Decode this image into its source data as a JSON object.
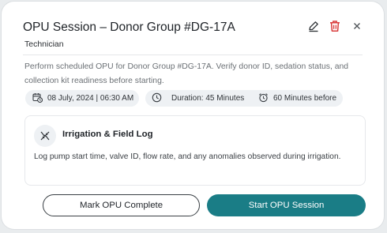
{
  "header": {
    "title": "OPU Session – Donor Group #DG-17A",
    "subtitle": "Technician",
    "edit_icon": "pencil-icon",
    "delete_icon": "trash-icon",
    "close_icon": "close-icon"
  },
  "description": "Perform scheduled OPU for Donor Group #DG-17A. Verify donor ID, sedation status, and collection kit readiness before starting.",
  "chips": [
    {
      "icon": "calendar-clock-icon",
      "label": "08 July, 2024 | 06:30 AM"
    },
    {
      "icon": "clock-icon",
      "label": "Duration: 45 Minutes"
    },
    {
      "icon": "alarm-icon",
      "label": "60 Minutes before"
    }
  ],
  "panel": {
    "icon": "dna-icon",
    "title": "Irrigation & Field Log",
    "text": "Log pump start time, valve ID, flow rate, and any anomalies observed during irrigation."
  },
  "actions": {
    "secondary_label": "Mark OPU Complete",
    "primary_label": "Start OPU Session"
  },
  "colors": {
    "primary": "#1a7d86",
    "delete": "#d93b3b",
    "chip_bg": "#eef1f4"
  }
}
